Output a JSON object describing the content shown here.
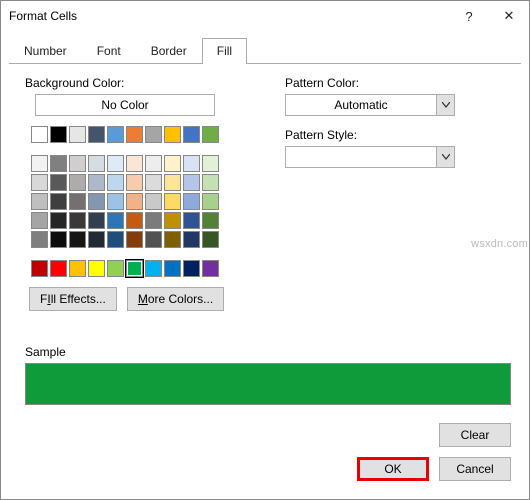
{
  "dialog": {
    "title": "Format Cells"
  },
  "titlebar": {
    "help": "?",
    "close": "✕"
  },
  "tabs": {
    "number": "Number",
    "font": "Font",
    "border": "Border",
    "fill": "Fill",
    "active": "fill"
  },
  "left": {
    "bgcolor_label": "Background Color:",
    "nocolor": "No Color",
    "fill_effects": "Fill Effects...",
    "more_colors": "More Colors...",
    "fill_effects_u": "I",
    "more_colors_u": "M"
  },
  "right": {
    "pattern_color_label": "Pattern Color:",
    "pattern_color_value": "Automatic",
    "pattern_style_label": "Pattern Style:",
    "pattern_style_value": ""
  },
  "sample": {
    "label": "Sample",
    "color": "#109b3b"
  },
  "buttons": {
    "clear": "Clear",
    "ok": "OK",
    "cancel": "Cancel"
  },
  "watermark": "wsxdn.com",
  "palette_top": [
    "#ffffff",
    "#000000",
    "#e7e6e6",
    "#44546a",
    "#5b9bd5",
    "#ed7d31",
    "#a5a5a5",
    "#ffc000",
    "#4472c4",
    "#70ad47"
  ],
  "palette_grid": [
    "#f2f2f2",
    "#808080",
    "#d0cece",
    "#d6dce4",
    "#deebf6",
    "#fbe5d5",
    "#ededed",
    "#fff2cc",
    "#d9e2f3",
    "#e2efd9",
    "#d8d8d8",
    "#595959",
    "#aeabab",
    "#adb9ca",
    "#bdd7ee",
    "#f7cbac",
    "#dbdbdb",
    "#fee599",
    "#b4c6e7",
    "#c5e0b3",
    "#bfbfbf",
    "#3f3f3f",
    "#757070",
    "#8496b0",
    "#9cc3e5",
    "#f4b183",
    "#c9c9c9",
    "#ffd965",
    "#8eaadb",
    "#a8d08d",
    "#a5a5a5",
    "#262626",
    "#3a3838",
    "#323f4f",
    "#2e75b5",
    "#c55a11",
    "#7b7b7b",
    "#bf9000",
    "#2f5496",
    "#538135",
    "#7f7f7f",
    "#0c0c0c",
    "#171616",
    "#222a35",
    "#1e4e79",
    "#833c0b",
    "#525252",
    "#7f6000",
    "#1f3864",
    "#375623"
  ],
  "palette_std": [
    "#c00000",
    "#ff0000",
    "#ffc000",
    "#ffff00",
    "#92d050",
    "#00b050",
    "#00b0f0",
    "#0070c0",
    "#002060",
    "#7030a0"
  ],
  "selected_std_index": 5
}
